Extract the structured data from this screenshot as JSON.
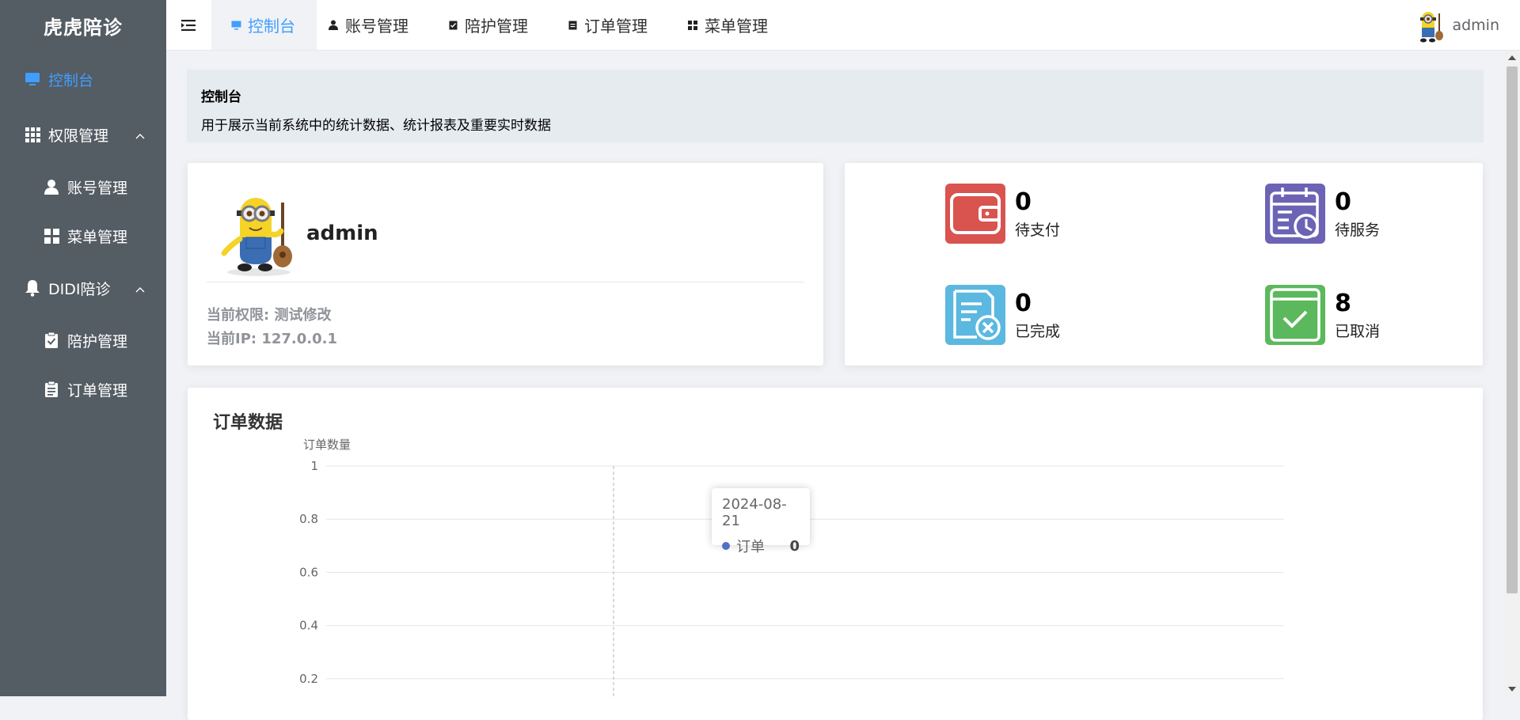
{
  "sidebar": {
    "brand": "虎虎陪诊",
    "items": [
      {
        "label": "控制台",
        "icon": "monitor-icon",
        "active": true
      },
      {
        "label": "权限管理",
        "icon": "grid-icon",
        "expanded": true
      },
      {
        "label": "账号管理",
        "icon": "user-icon"
      },
      {
        "label": "菜单管理",
        "icon": "menu-blocks-icon"
      },
      {
        "label": "DIDI陪诊",
        "icon": "bell-icon",
        "expanded": true
      },
      {
        "label": "陪护管理",
        "icon": "clipboard-check-icon"
      },
      {
        "label": "订单管理",
        "icon": "document-icon"
      }
    ]
  },
  "topbar": {
    "tabs": [
      {
        "label": "控制台",
        "icon": "monitor-icon",
        "active": true
      },
      {
        "label": "账号管理",
        "icon": "user-icon"
      },
      {
        "label": "陪护管理",
        "icon": "clipboard-check-icon"
      },
      {
        "label": "订单管理",
        "icon": "document-icon"
      },
      {
        "label": "菜单管理",
        "icon": "menu-blocks-icon"
      }
    ],
    "username": "admin"
  },
  "page_header": {
    "title": "控制台",
    "description": "用于展示当前系统中的统计数据、统计报表及重要实时数据"
  },
  "user_card": {
    "name": "admin",
    "role_line": "当前权限: 测试修改",
    "ip_line": "当前IP: 127.0.0.1"
  },
  "stats": [
    {
      "value": "0",
      "label": "待支付",
      "color": "#d9534f",
      "icon": "wallet-icon"
    },
    {
      "value": "0",
      "label": "待服务",
      "color": "#6c63b5",
      "icon": "calendar-clock-icon"
    },
    {
      "value": "0",
      "label": "已完成",
      "color": "#5bb8e0",
      "icon": "document-cancel-icon"
    },
    {
      "value": "8",
      "label": "已取消",
      "color": "#5cb85c",
      "icon": "check-square-icon"
    }
  ],
  "order_chart": {
    "title": "订单数据",
    "tooltip": {
      "date": "2024-08-21",
      "series": "订单",
      "value": "0"
    }
  },
  "chart_data": {
    "type": "line",
    "ylabel": "订单数量",
    "ylim": [
      0,
      1
    ],
    "y_ticks": [
      "1",
      "0.8",
      "0.6",
      "0.4",
      "0.2"
    ],
    "x": [
      "2024-08-21"
    ],
    "series": [
      {
        "name": "订单",
        "values": [
          0
        ],
        "color": "#5470c6"
      }
    ],
    "grid": true
  },
  "colors": {
    "sidebar_bg": "#545c64",
    "accent": "#409eff",
    "page_bg": "#f0f2f5"
  }
}
